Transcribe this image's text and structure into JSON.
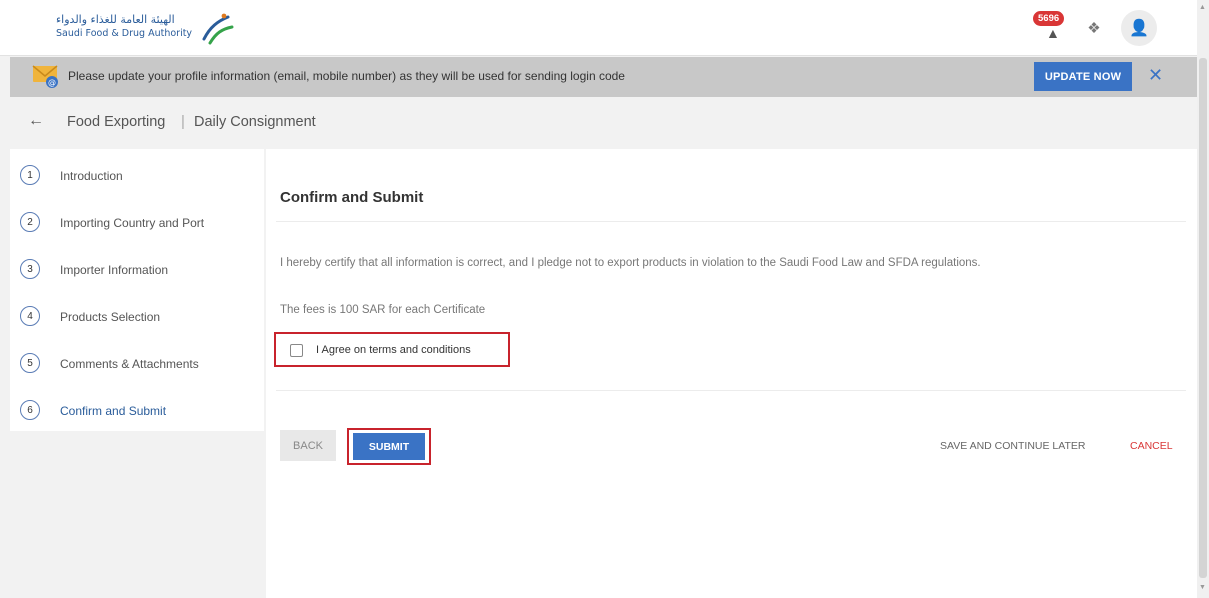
{
  "header": {
    "logo_ar": "الهيئة العامة للغذاء والدواء",
    "logo_en": "Saudi Food & Drug Authority",
    "notification_count": "5696",
    "icons": [
      "bell-icon",
      "box-icon",
      "user-icon"
    ]
  },
  "banner": {
    "message": "Please update your profile information (email, mobile number) as they will be used for sending login code",
    "update_label": "UPDATE NOW",
    "close_glyph": "✕"
  },
  "breadcrumb": {
    "back_glyph": "←",
    "section": "Food Exporting",
    "separator": "|",
    "page": "Daily Consignment"
  },
  "steps": [
    {
      "num": "1",
      "label": "Introduction"
    },
    {
      "num": "2",
      "label": "Importing Country and Port"
    },
    {
      "num": "3",
      "label": "Importer Information"
    },
    {
      "num": "4",
      "label": "Products Selection"
    },
    {
      "num": "5",
      "label": "Comments & Attachments"
    },
    {
      "num": "6",
      "label": "Confirm and Submit"
    }
  ],
  "main": {
    "title": "Confirm and Submit",
    "certify": "I hereby certify that all information is correct, and I pledge not to export products in violation to the Saudi Food Law and SFDA regulations.",
    "fees": "The fees is 100 SAR for each Certificate",
    "agree_label": "I Agree on terms and conditions",
    "agree_checked": false,
    "back_label": "BACK",
    "submit_label": "SUBMIT",
    "save_later_label": "SAVE AND CONTINUE LATER",
    "cancel_label": "CANCEL"
  },
  "colors": {
    "primary": "#3a73c5",
    "highlight": "#c8232c",
    "danger": "#d93636"
  }
}
